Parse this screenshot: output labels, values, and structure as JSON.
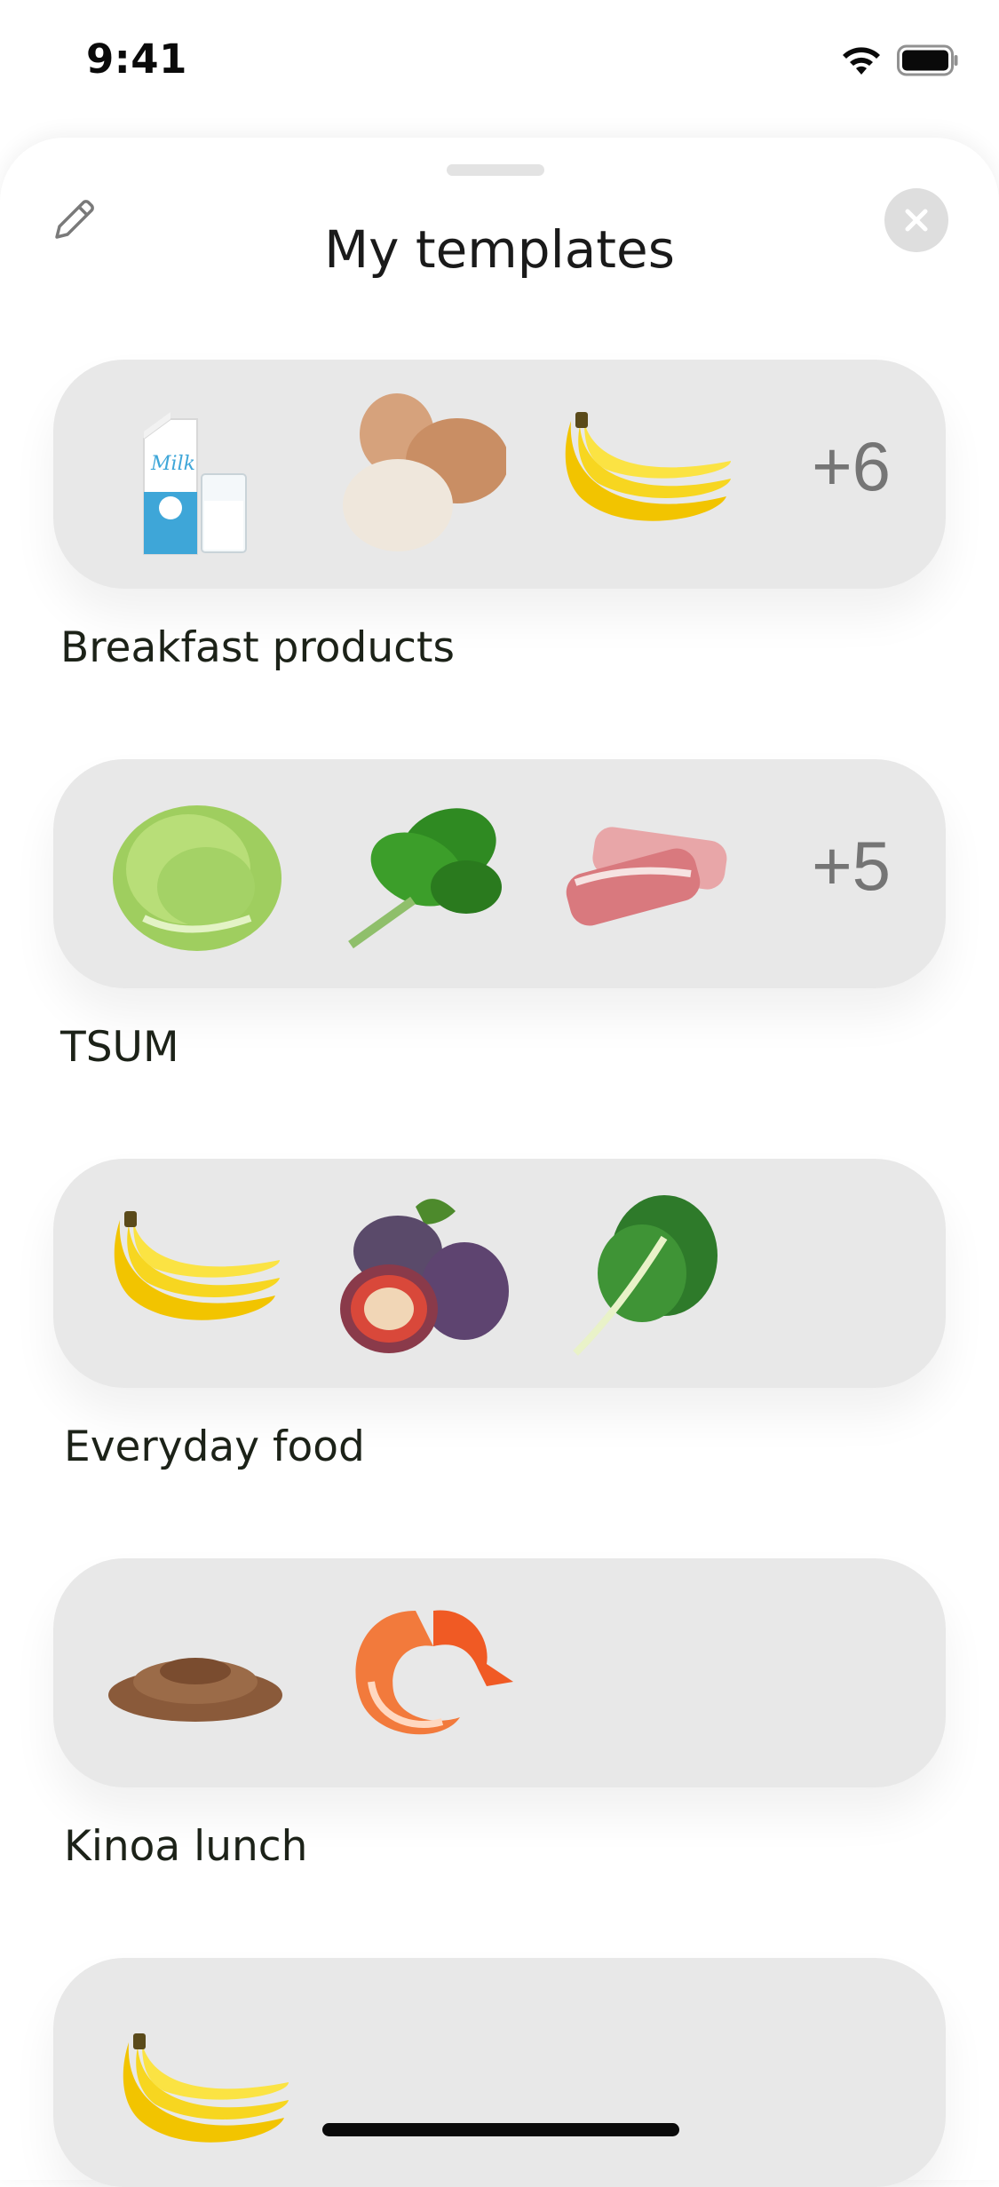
{
  "status_bar": {
    "time": "9:41"
  },
  "sheet": {
    "title": "My templates"
  },
  "templates": [
    {
      "name": "Breakfast products",
      "more": "+6",
      "items": [
        "milk-carton-glass",
        "eggs",
        "bananas"
      ]
    },
    {
      "name": "TSUM",
      "more": "+5",
      "items": [
        "lettuce",
        "spinach",
        "bacon"
      ]
    },
    {
      "name": "Everyday food",
      "more": "",
      "items": [
        "bananas",
        "figs",
        "chard"
      ]
    },
    {
      "name": "Kinoa lunch",
      "more": "",
      "items": [
        "buckwheat",
        "shrimp"
      ]
    },
    {
      "name": "",
      "more": "",
      "items": [
        "bananas"
      ]
    }
  ],
  "colors": {
    "card_bg": "#e8e8e8",
    "more_text": "#757575",
    "close_bg": "#dedede"
  }
}
